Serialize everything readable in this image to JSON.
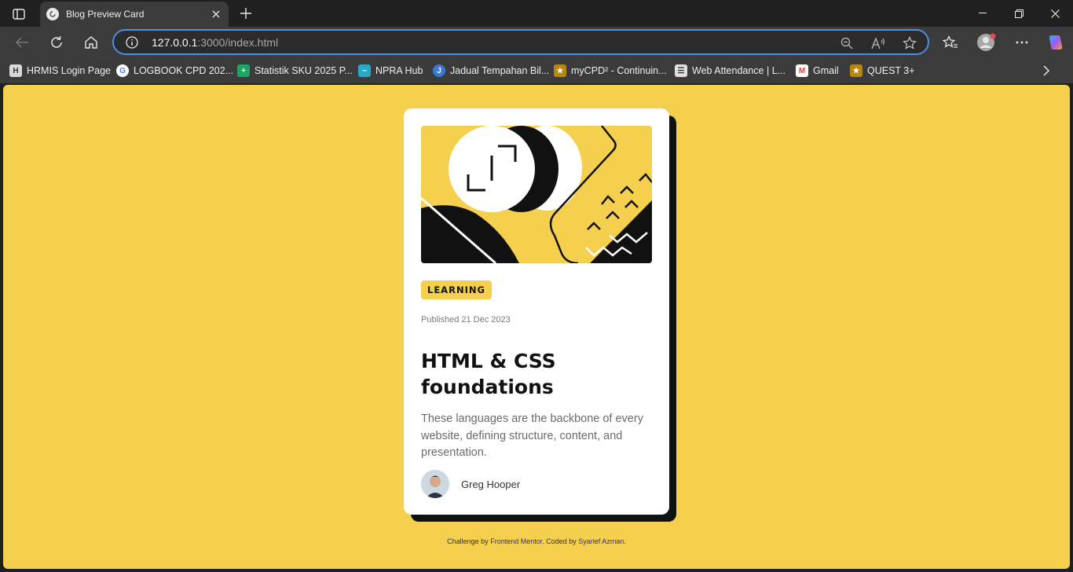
{
  "browser": {
    "tab_title": "Blog Preview Card",
    "url_host": "127.0.0.1",
    "url_rest": ":3000/index.html",
    "icons": [
      "sidebar-icon",
      "close-icon",
      "plus-icon",
      "minimize-icon",
      "restore-icon",
      "back-icon",
      "refresh-icon",
      "home-icon",
      "info-icon",
      "zoom-out-icon",
      "read-aloud-icon",
      "star-icon",
      "favorites-icon",
      "profile-icon",
      "more-icon",
      "copilot-icon"
    ]
  },
  "bookmarks": [
    {
      "label": "HRMIS Login Page",
      "color": "#d8d8d8"
    },
    {
      "label": "LOGBOOK CPD 202...",
      "color": "#ffffff"
    },
    {
      "label": "Statistik SKU 2025 P...",
      "color": "#1fa463"
    },
    {
      "label": "NPRA Hub",
      "color": "#2aa8c8"
    },
    {
      "label": "Jadual Tempahan Bil...",
      "color": "#3c78d8"
    },
    {
      "label": "myCPD² - Continuin...",
      "color": "#b8860b"
    },
    {
      "label": "Web Attendance | L...",
      "color": "#e0e0e0"
    },
    {
      "label": "Gmail",
      "color": "#ea4335"
    },
    {
      "label": "QUEST 3+",
      "color": "#b8860b"
    }
  ],
  "card": {
    "tag": "LEARNING",
    "published": "Published 21 Dec 2023",
    "title": "HTML & CSS foundations",
    "description": "These languages are the backbone of every website, defining structure, content, and presentation.",
    "author": "Greg Hooper"
  },
  "attribution": {
    "prefix": "Challenge by",
    "link1": "Frontend Mentor",
    "middle": ". Coded by",
    "link2": "Syarief Azman",
    "suffix": "."
  },
  "colors": {
    "page_bg": "#f4d04e",
    "card_bg": "#ffffff",
    "shadow": "#111111",
    "address_border": "#4d8fe8"
  }
}
